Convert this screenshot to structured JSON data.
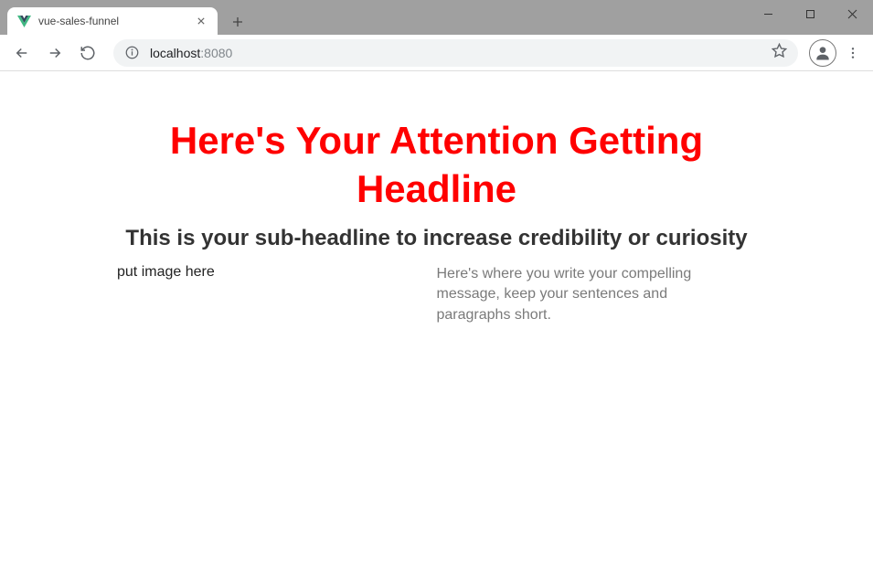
{
  "tab": {
    "title": "vue-sales-funnel"
  },
  "omnibox": {
    "host": "localhost",
    "port": ":8080"
  },
  "page": {
    "headline": "Here's Your Attention Getting Headline",
    "subhead": "This is your sub-headline to increase credibility or curiosity",
    "left_text": "put image here",
    "right_text": "Here's where you write your compelling message, keep your sentences and paragraphs short."
  }
}
